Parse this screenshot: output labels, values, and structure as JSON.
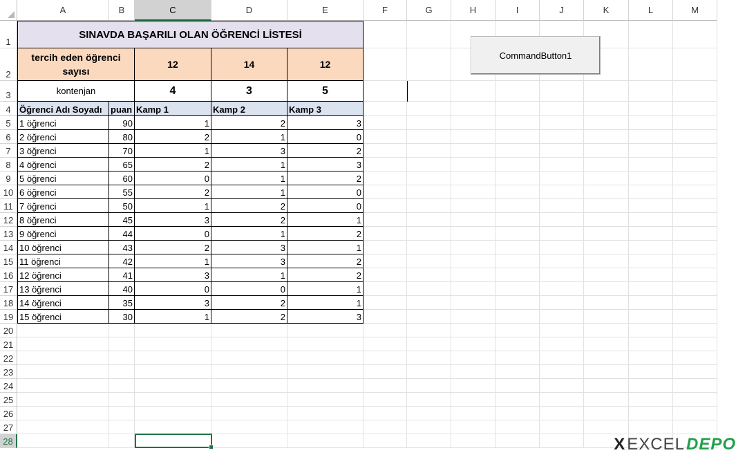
{
  "columns": [
    "A",
    "B",
    "C",
    "D",
    "E",
    "F",
    "G",
    "H",
    "I",
    "J",
    "K",
    "L",
    "M"
  ],
  "rows": [
    "1",
    "2",
    "3",
    "4",
    "5",
    "6",
    "7",
    "8",
    "9",
    "10",
    "11",
    "12",
    "13",
    "14",
    "15",
    "16",
    "17",
    "18",
    "19",
    "20",
    "21",
    "22",
    "23",
    "24",
    "25",
    "26",
    "27",
    "28"
  ],
  "sheet": {
    "title": "SINAVDA BAŞARILI OLAN ÖĞRENCİ LİSTESİ",
    "tercih_label": "tercih eden öğrenci sayısı",
    "tercih_values": [
      "12",
      "14",
      "12"
    ],
    "kontenjan_label": "kontenjan",
    "kontenjan_values": [
      "4",
      "3",
      "5"
    ],
    "headers": [
      "Öğrenci Adı Soyadı",
      "puan",
      "Kamp 1",
      "Kamp 2",
      "Kamp 3"
    ],
    "students": [
      {
        "name": "1 öğrenci",
        "puan": "90",
        "k1": "1",
        "k2": "2",
        "k3": "3"
      },
      {
        "name": "2 öğrenci",
        "puan": "80",
        "k1": "2",
        "k2": "1",
        "k3": "0"
      },
      {
        "name": "3 öğrenci",
        "puan": "70",
        "k1": "1",
        "k2": "3",
        "k3": "2"
      },
      {
        "name": "4 öğrenci",
        "puan": "65",
        "k1": "2",
        "k2": "1",
        "k3": "3"
      },
      {
        "name": "5 öğrenci",
        "puan": "60",
        "k1": "0",
        "k2": "1",
        "k3": "2"
      },
      {
        "name": "6 öğrenci",
        "puan": "55",
        "k1": "2",
        "k2": "1",
        "k3": "0"
      },
      {
        "name": "7 öğrenci",
        "puan": "50",
        "k1": "1",
        "k2": "2",
        "k3": "0"
      },
      {
        "name": "8 öğrenci",
        "puan": "45",
        "k1": "3",
        "k2": "2",
        "k3": "1"
      },
      {
        "name": "9 öğrenci",
        "puan": "44",
        "k1": "0",
        "k2": "1",
        "k3": "2"
      },
      {
        "name": "10 öğrenci",
        "puan": "43",
        "k1": "2",
        "k2": "3",
        "k3": "1"
      },
      {
        "name": "11 öğrenci",
        "puan": "42",
        "k1": "1",
        "k2": "3",
        "k3": "2"
      },
      {
        "name": "12 öğrenci",
        "puan": "41",
        "k1": "3",
        "k2": "1",
        "k3": "2"
      },
      {
        "name": "13 öğrenci",
        "puan": "40",
        "k1": "0",
        "k2": "0",
        "k3": "1"
      },
      {
        "name": "14 öğrenci",
        "puan": "35",
        "k1": "3",
        "k2": "2",
        "k3": "1"
      },
      {
        "name": "15 öğrenci",
        "puan": "30",
        "k1": "1",
        "k2": "2",
        "k3": "3"
      }
    ]
  },
  "command_button": {
    "label": "CommandButton1"
  },
  "selection": {
    "column": "C",
    "row": "28"
  },
  "watermark": {
    "x": "X",
    "excel": "EXCEL",
    "depo": "DEPO"
  },
  "colors": {
    "accent": "#217346",
    "title_fill": "#e4e0ee",
    "peach_fill": "#fbd9bf",
    "header_fill": "#dce3f0"
  }
}
